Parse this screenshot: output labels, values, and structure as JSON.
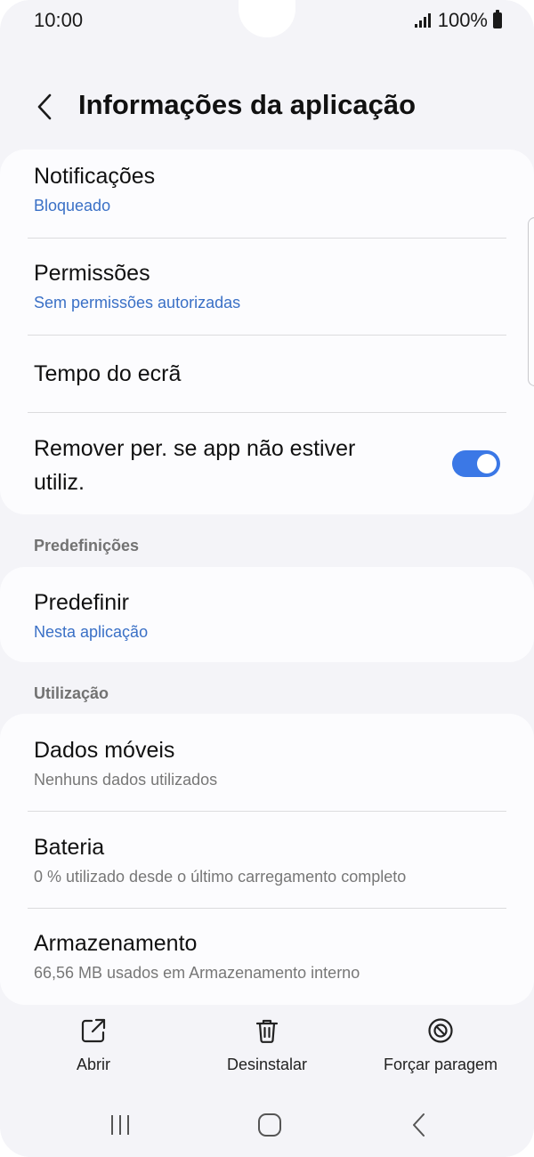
{
  "status_bar": {
    "time": "10:00",
    "battery_text": "100%"
  },
  "header": {
    "title": "Informações da aplicação"
  },
  "group1": {
    "notifications": {
      "title": "Notificações",
      "subtitle": "Bloqueado"
    },
    "permissions": {
      "title": "Permissões",
      "subtitle": "Sem permissões autorizadas"
    },
    "screen_time": {
      "title": "Tempo do ecrã"
    },
    "remove_permissions": {
      "title_line1": "Remover per. se app não estiver",
      "title_line2": "utiliz.",
      "toggle_on": true
    }
  },
  "defaults_section": {
    "label": "Predefinições",
    "set_default": {
      "title": "Predefinir",
      "subtitle": "Nesta aplicação"
    }
  },
  "usage_section": {
    "label": "Utilização",
    "mobile_data": {
      "title": "Dados móveis",
      "subtitle": "Nenhuns dados utilizados"
    },
    "battery": {
      "title": "Bateria",
      "subtitle": "0 % utilizado desde o último carregamento completo"
    },
    "storage": {
      "title": "Armazenamento",
      "subtitle": "66,56 MB usados em Armazenamento interno"
    }
  },
  "bottom_actions": {
    "open": {
      "label": "Abrir",
      "icon": "open-external-icon"
    },
    "uninstall": {
      "label": "Desinstalar",
      "icon": "trash-icon"
    },
    "force_stop": {
      "label": "Forçar paragem",
      "icon": "stop-icon"
    }
  },
  "colors": {
    "accent": "#3b78e6",
    "link_text": "#3a70c6",
    "background": "#f4f4f8",
    "card": "#fcfcfe"
  }
}
